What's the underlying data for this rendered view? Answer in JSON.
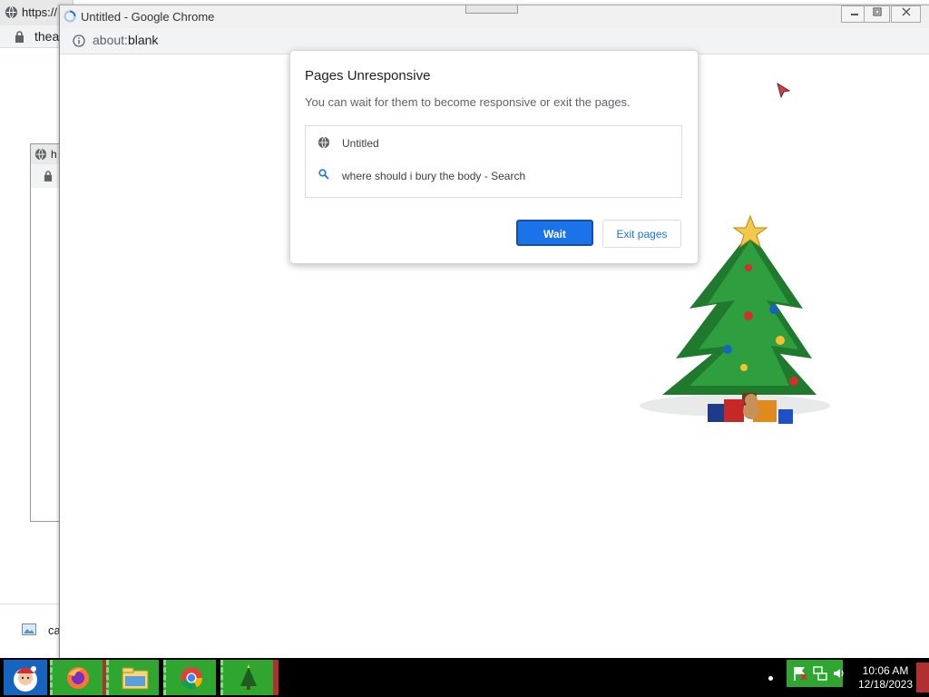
{
  "background_window_1": {
    "tab_title": "https://",
    "url": "thea",
    "download_label": "ca"
  },
  "background_window_2": {
    "tab_title": "h"
  },
  "main_window": {
    "title": "Untitled - Google Chrome",
    "url_prefix": "about:",
    "url_rest": "blank"
  },
  "dialog": {
    "title": "Pages Unresponsive",
    "subtitle": "You can wait for them to become responsive or exit the pages.",
    "pages": [
      {
        "icon": "globe-icon",
        "label": "Untitled"
      },
      {
        "icon": "search-icon",
        "label": "where should i bury the body - Search"
      }
    ],
    "wait_label": "Wait",
    "exit_label": "Exit pages",
    "accent": "#1a73e8"
  },
  "taskbar": {
    "start_icon": "santa-icon",
    "apps": [
      "firefox-icon",
      "file-explorer-icon",
      "chrome-icon",
      "christmas-tree-icon"
    ],
    "time": "10:06 AM",
    "date": "12/18/2023"
  }
}
